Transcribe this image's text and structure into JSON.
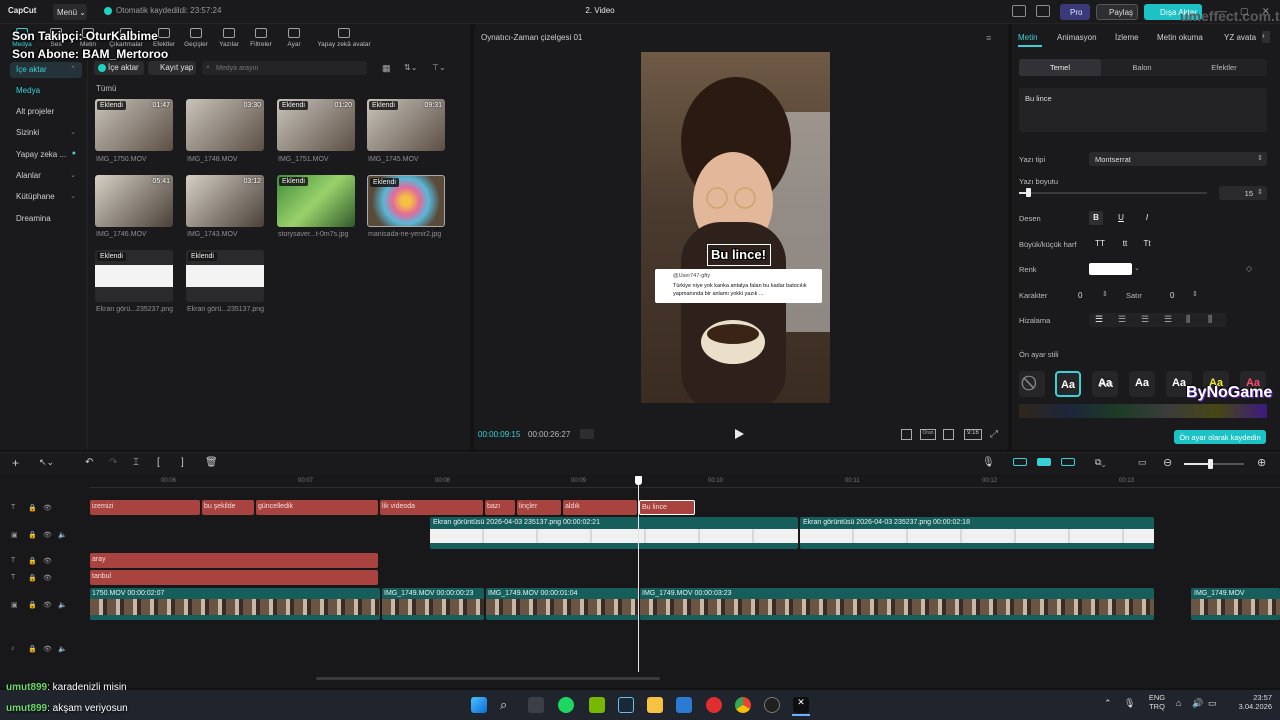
{
  "titlebar": {
    "app_name": "CapCut",
    "menu_label": "Menü",
    "autosave": "Otomatik kaydedildi: 23:57:24",
    "window_title": "2. Video",
    "pro_label": "Pro",
    "share_label": "Paylaş",
    "export_label": "Dışa Aktar",
    "watermark": "umeffect.com.tr"
  },
  "overlay": {
    "line1": "Son Takipçi: OturKalbime",
    "line2": "Son Abone: BAM_Mertoroo"
  },
  "toolbar": {
    "items": [
      "Medya",
      "Ses",
      "Metin",
      "Çıkartmalar",
      "Efektler",
      "Geçişler",
      "Yazılar",
      "Filtreler",
      "Ayar",
      "Yapay zekâ avatar"
    ]
  },
  "sidebar": {
    "import_label": "İçe aktar",
    "items": [
      "Medya",
      "Alt projeler",
      "Sizinki",
      "Yapay zeka ...",
      "Alanlar",
      "Kütüphane",
      "Dreamina"
    ]
  },
  "media": {
    "import_btn": "İçe aktar",
    "record_btn": "Kayıt yap",
    "search_placeholder": "Medya arayın",
    "section": "Tümü",
    "items": [
      {
        "name": "IMG_1750.MOV",
        "badge": "Eklendi",
        "duration": "01:47"
      },
      {
        "name": "IMG_1748.MOV",
        "badge": "Eklendi",
        "duration": "03:30"
      },
      {
        "name": "IMG_1751.MOV",
        "badge": "Eklendi",
        "duration": "01:20"
      },
      {
        "name": "IMG_1745.MOV",
        "badge": "Eklendi",
        "duration": "09:31"
      },
      {
        "name": "IMG_1746.MOV",
        "badge": "",
        "duration": "05:41"
      },
      {
        "name": "IMG_1743.MOV",
        "badge": "",
        "duration": "03:12"
      },
      {
        "name": "storysaver...t-0m7s.jpg",
        "badge": "Eklendi",
        "duration": ""
      },
      {
        "name": "manisada-ne-yenir2.jpg",
        "badge": "Eklendi",
        "duration": ""
      },
      {
        "name": "Ekran görü...235237.png",
        "badge": "Eklendi",
        "duration": ""
      },
      {
        "name": "Ekran görü...235137.png",
        "badge": "Eklendi",
        "duration": ""
      }
    ]
  },
  "player": {
    "title": "Oynatıcı-Zaman çizelgesi 01",
    "caption": "Bu lince!",
    "tweet_user": "@User747-gfty",
    "tweet_text1": "Türkiye niye yok kanka antalya falan bu kadar batocılık",
    "tweet_text2": "yapmanında bir anlamı yokki yazık ...",
    "current_time": "00:00:09:15",
    "total_time": "00:00:26:27",
    "ratio_label": "Oran",
    "aspect": "9:16"
  },
  "right_panel": {
    "tabs": [
      "Metin",
      "Animasyon",
      "İzleme",
      "Metin okuma",
      "YZ avata"
    ],
    "subtabs": [
      "Temel",
      "Balon",
      "Efektler"
    ],
    "text_value": "Bu lince",
    "font_label": "Yazı tipi",
    "font_value": "Montserrat",
    "size_label": "Yazı boyutu",
    "size_value": "15",
    "size_fraction": 0.05,
    "pattern_label": "Desen",
    "case_label": "Büyük/küçük harf",
    "case_opts": [
      "TT",
      "tt",
      "Tt"
    ],
    "color_label": "Renk",
    "char_label": "Karakter",
    "char_value": "0",
    "line_label": "Satır",
    "line_value": "0",
    "align_label": "Hizalama",
    "preset_label": "Ön ayar stili",
    "preset_overlay": "ByNoGame",
    "save_preset": "Ön ayar olarak kaydedin"
  },
  "timeline": {
    "ruler": [
      "00:06",
      "00:07",
      "00:08",
      "00:09",
      "00:10",
      "00:11",
      "00:12",
      "00:13"
    ],
    "text_clips": [
      "izemizi",
      "bu şekilde",
      "güncelledik",
      "lik videoda",
      "bazı",
      "linçler",
      "aldık",
      "Bu lince"
    ],
    "image_clips": [
      "Ekran görüntüsü 2026-04-03 235137.png  00:00:02:21",
      "Ekran görüntüsü 2026-04-03 235237.png  00:00:02:18"
    ],
    "text_clips2": [
      "aray",
      "tanbul"
    ],
    "video_clips": [
      "1750.MOV  00:00:02:07",
      "IMG_1749.MOV  00:00:00:23",
      "IMG_1749.MOV  00:00:01:04",
      "IMG_1749.MOV  00:00:03:23",
      "IMG_1749.MOV"
    ]
  },
  "chat": [
    {
      "user": "umut899",
      "msg": ": karadenizli misin"
    },
    {
      "user": "umut899",
      "msg": ": akşam veriyosun"
    }
  ],
  "taskbar": {
    "lang1": "ENG",
    "lang2": "TRQ",
    "time": "23:57",
    "date": "3.04.2026"
  }
}
